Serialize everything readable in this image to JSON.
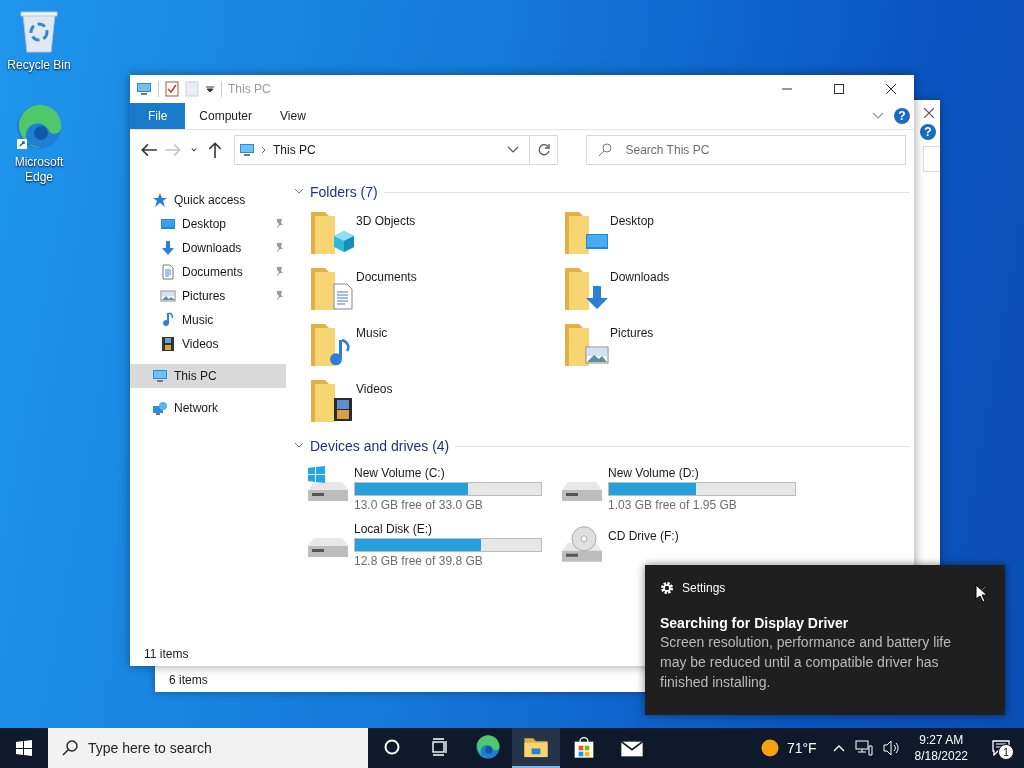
{
  "desktop_icons": [
    {
      "label": "Recycle Bin",
      "kind": "recycle"
    },
    {
      "label": "Microsoft Edge",
      "kind": "browser"
    }
  ],
  "back_window": {
    "help": "?",
    "status": "6 items"
  },
  "window": {
    "title": "This PC",
    "help": "?",
    "ribbon_tabs": [
      {
        "label": "File",
        "selected": true
      },
      {
        "label": "Computer",
        "selected": false
      },
      {
        "label": "View",
        "selected": false
      }
    ],
    "nav_buttons": [
      {
        "kind": "back",
        "disabled": false
      },
      {
        "kind": "forward",
        "disabled": true
      },
      {
        "kind": "recent",
        "disabled": false
      },
      {
        "kind": "up",
        "disabled": false
      }
    ],
    "address": {
      "path": "This PC"
    },
    "search": {
      "placeholder": "Search This PC"
    },
    "nav": [
      {
        "label": "Quick access",
        "kind": "star",
        "selected": false,
        "children": [
          {
            "label": "Desktop",
            "kind": "desktop",
            "pinned": true,
            "selected": false
          },
          {
            "label": "Downloads",
            "kind": "download",
            "pinned": true,
            "selected": false
          },
          {
            "label": "Documents",
            "kind": "document",
            "pinned": true,
            "selected": false
          },
          {
            "label": "Pictures",
            "kind": "pictures",
            "pinned": true,
            "selected": false
          },
          {
            "label": "Music",
            "kind": "music",
            "pinned": false,
            "selected": false
          },
          {
            "label": "Videos",
            "kind": "videos",
            "pinned": false,
            "selected": false
          }
        ]
      },
      {
        "label": "This PC",
        "kind": "pc",
        "selected": true
      },
      {
        "label": "Network",
        "kind": "network",
        "selected": false
      }
    ],
    "folders": {
      "heading": "Folders (7)",
      "items": [
        {
          "label": "3D Objects",
          "kind": "cube"
        },
        {
          "label": "Desktop",
          "kind": "desktop"
        },
        {
          "label": "Documents",
          "kind": "document"
        },
        {
          "label": "Downloads",
          "kind": "download"
        },
        {
          "label": "Music",
          "kind": "music"
        },
        {
          "label": "Pictures",
          "kind": "pictures"
        },
        {
          "label": "Videos",
          "kind": "videos"
        }
      ]
    },
    "drives": {
      "heading": "Devices and drives (4)",
      "items": [
        {
          "label": "New Volume (C:)",
          "kind": "system",
          "level": 0.61,
          "reading": "13.0 GB free of 33.0 GB"
        },
        {
          "label": "New Volume (D:)",
          "kind": "disk",
          "level": 0.47,
          "reading": "1.03 GB free of 1.95 GB"
        },
        {
          "label": "Local Disk (E:)",
          "kind": "disk",
          "level": 0.68,
          "reading": "12.8 GB free of 39.8 GB"
        },
        {
          "label": "CD Drive (F:)",
          "kind": "cd"
        }
      ]
    },
    "status": "11 items"
  },
  "toast": {
    "app": "Settings",
    "title": "Searching for Display Driver",
    "body": "Screen resolution, performance and battery life may be reduced until a compatible driver has finished installing."
  },
  "taskbar": {
    "search_placeholder": "Type here to search",
    "apps": [
      {
        "kind": "cortana",
        "active": false
      },
      {
        "kind": "taskview",
        "active": false
      },
      {
        "kind": "browser",
        "active": false
      },
      {
        "kind": "explorer",
        "active": true
      },
      {
        "kind": "store",
        "active": false
      },
      {
        "kind": "mail",
        "active": false
      }
    ],
    "weather": "71°F",
    "time": "9:27 AM",
    "date": "8/18/2022",
    "notifications": "1"
  }
}
